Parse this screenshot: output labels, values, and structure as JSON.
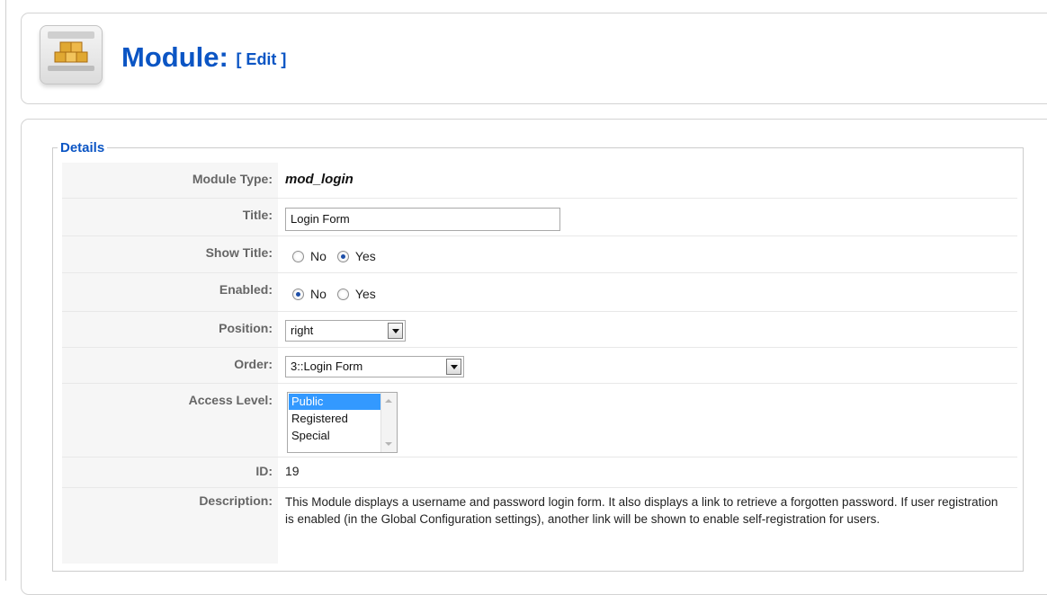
{
  "header": {
    "title": "Module:",
    "edit_label": "[ Edit ]"
  },
  "details": {
    "legend": "Details",
    "module_type_label": "Module Type:",
    "module_type_value": "mod_login",
    "title_label": "Title:",
    "title_value": "Login Form",
    "show_title_label": "Show Title:",
    "show_title_no": "No",
    "show_title_yes": "Yes",
    "show_title_selected": "Yes",
    "enabled_label": "Enabled:",
    "enabled_no": "No",
    "enabled_yes": "Yes",
    "enabled_selected": "No",
    "position_label": "Position:",
    "position_value": "right",
    "order_label": "Order:",
    "order_value": "3::Login Form",
    "access_label": "Access Level:",
    "access_options": [
      "Public",
      "Registered",
      "Special"
    ],
    "access_selected": "Public",
    "id_label": "ID:",
    "id_value": "19",
    "description_label": "Description:",
    "description_value": "This Module displays a username and password login form. It also displays a link to retrieve a forgotten password. If user registration is enabled (in the Global Configuration settings), another link will be shown to enable self-registration for users."
  },
  "colors": {
    "accent": "#0b55c4",
    "label": "#666666",
    "selected_option": "#3399ff"
  },
  "icons": {
    "module": "module-boxes-icon"
  }
}
